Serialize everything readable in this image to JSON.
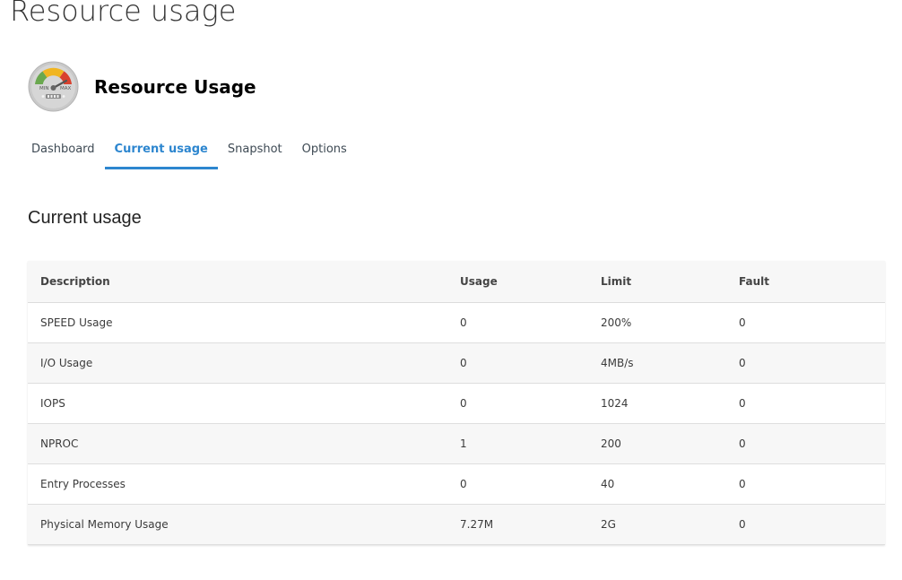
{
  "page": {
    "heading": "Resource usage"
  },
  "app": {
    "title": "Resource Usage",
    "logo": {
      "icon": "gauge-icon",
      "min_label": "MIN",
      "max_label": "MAX"
    }
  },
  "tabs": [
    {
      "label": "Dashboard",
      "active": false
    },
    {
      "label": "Current usage",
      "active": true
    },
    {
      "label": "Snapshot",
      "active": false
    },
    {
      "label": "Options",
      "active": false
    }
  ],
  "section": {
    "title": "Current usage"
  },
  "table": {
    "headers": {
      "description": "Description",
      "usage": "Usage",
      "limit": "Limit",
      "fault": "Fault"
    },
    "rows": [
      {
        "description": "SPEED Usage",
        "usage": "0",
        "limit": "200%",
        "fault": "0"
      },
      {
        "description": "I/O Usage",
        "usage": "0",
        "limit": "4MB/s",
        "fault": "0"
      },
      {
        "description": "IOPS",
        "usage": "0",
        "limit": "1024",
        "fault": "0"
      },
      {
        "description": "NPROC",
        "usage": "1",
        "limit": "200",
        "fault": "0"
      },
      {
        "description": "Entry Processes",
        "usage": "0",
        "limit": "40",
        "fault": "0"
      },
      {
        "description": "Physical Memory Usage",
        "usage": "7.27M",
        "limit": "2G",
        "fault": "0"
      }
    ]
  },
  "colors": {
    "accent": "#2d86cf",
    "gauge_green": "#6aa84f",
    "gauge_yellow": "#f1b521",
    "gauge_red": "#d9412e",
    "gauge_face": "#cfcfcf"
  }
}
